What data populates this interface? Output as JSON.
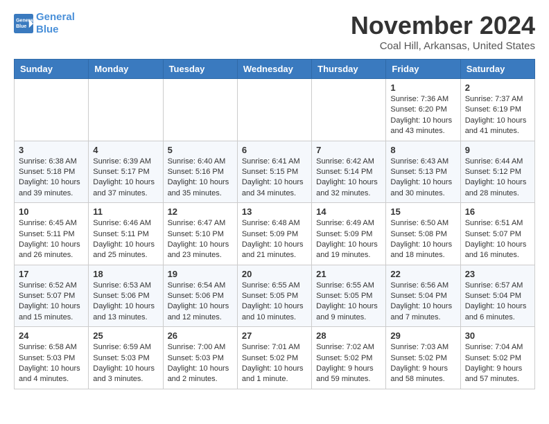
{
  "logo": {
    "line1": "General",
    "line2": "Blue"
  },
  "title": "November 2024",
  "location": "Coal Hill, Arkansas, United States",
  "weekdays": [
    "Sunday",
    "Monday",
    "Tuesday",
    "Wednesday",
    "Thursday",
    "Friday",
    "Saturday"
  ],
  "weeks": [
    [
      {
        "day": "",
        "info": ""
      },
      {
        "day": "",
        "info": ""
      },
      {
        "day": "",
        "info": ""
      },
      {
        "day": "",
        "info": ""
      },
      {
        "day": "",
        "info": ""
      },
      {
        "day": "1",
        "info": "Sunrise: 7:36 AM\nSunset: 6:20 PM\nDaylight: 10 hours and 43 minutes."
      },
      {
        "day": "2",
        "info": "Sunrise: 7:37 AM\nSunset: 6:19 PM\nDaylight: 10 hours and 41 minutes."
      }
    ],
    [
      {
        "day": "3",
        "info": "Sunrise: 6:38 AM\nSunset: 5:18 PM\nDaylight: 10 hours and 39 minutes."
      },
      {
        "day": "4",
        "info": "Sunrise: 6:39 AM\nSunset: 5:17 PM\nDaylight: 10 hours and 37 minutes."
      },
      {
        "day": "5",
        "info": "Sunrise: 6:40 AM\nSunset: 5:16 PM\nDaylight: 10 hours and 35 minutes."
      },
      {
        "day": "6",
        "info": "Sunrise: 6:41 AM\nSunset: 5:15 PM\nDaylight: 10 hours and 34 minutes."
      },
      {
        "day": "7",
        "info": "Sunrise: 6:42 AM\nSunset: 5:14 PM\nDaylight: 10 hours and 32 minutes."
      },
      {
        "day": "8",
        "info": "Sunrise: 6:43 AM\nSunset: 5:13 PM\nDaylight: 10 hours and 30 minutes."
      },
      {
        "day": "9",
        "info": "Sunrise: 6:44 AM\nSunset: 5:12 PM\nDaylight: 10 hours and 28 minutes."
      }
    ],
    [
      {
        "day": "10",
        "info": "Sunrise: 6:45 AM\nSunset: 5:11 PM\nDaylight: 10 hours and 26 minutes."
      },
      {
        "day": "11",
        "info": "Sunrise: 6:46 AM\nSunset: 5:11 PM\nDaylight: 10 hours and 25 minutes."
      },
      {
        "day": "12",
        "info": "Sunrise: 6:47 AM\nSunset: 5:10 PM\nDaylight: 10 hours and 23 minutes."
      },
      {
        "day": "13",
        "info": "Sunrise: 6:48 AM\nSunset: 5:09 PM\nDaylight: 10 hours and 21 minutes."
      },
      {
        "day": "14",
        "info": "Sunrise: 6:49 AM\nSunset: 5:09 PM\nDaylight: 10 hours and 19 minutes."
      },
      {
        "day": "15",
        "info": "Sunrise: 6:50 AM\nSunset: 5:08 PM\nDaylight: 10 hours and 18 minutes."
      },
      {
        "day": "16",
        "info": "Sunrise: 6:51 AM\nSunset: 5:07 PM\nDaylight: 10 hours and 16 minutes."
      }
    ],
    [
      {
        "day": "17",
        "info": "Sunrise: 6:52 AM\nSunset: 5:07 PM\nDaylight: 10 hours and 15 minutes."
      },
      {
        "day": "18",
        "info": "Sunrise: 6:53 AM\nSunset: 5:06 PM\nDaylight: 10 hours and 13 minutes."
      },
      {
        "day": "19",
        "info": "Sunrise: 6:54 AM\nSunset: 5:06 PM\nDaylight: 10 hours and 12 minutes."
      },
      {
        "day": "20",
        "info": "Sunrise: 6:55 AM\nSunset: 5:05 PM\nDaylight: 10 hours and 10 minutes."
      },
      {
        "day": "21",
        "info": "Sunrise: 6:55 AM\nSunset: 5:05 PM\nDaylight: 10 hours and 9 minutes."
      },
      {
        "day": "22",
        "info": "Sunrise: 6:56 AM\nSunset: 5:04 PM\nDaylight: 10 hours and 7 minutes."
      },
      {
        "day": "23",
        "info": "Sunrise: 6:57 AM\nSunset: 5:04 PM\nDaylight: 10 hours and 6 minutes."
      }
    ],
    [
      {
        "day": "24",
        "info": "Sunrise: 6:58 AM\nSunset: 5:03 PM\nDaylight: 10 hours and 4 minutes."
      },
      {
        "day": "25",
        "info": "Sunrise: 6:59 AM\nSunset: 5:03 PM\nDaylight: 10 hours and 3 minutes."
      },
      {
        "day": "26",
        "info": "Sunrise: 7:00 AM\nSunset: 5:03 PM\nDaylight: 10 hours and 2 minutes."
      },
      {
        "day": "27",
        "info": "Sunrise: 7:01 AM\nSunset: 5:02 PM\nDaylight: 10 hours and 1 minute."
      },
      {
        "day": "28",
        "info": "Sunrise: 7:02 AM\nSunset: 5:02 PM\nDaylight: 9 hours and 59 minutes."
      },
      {
        "day": "29",
        "info": "Sunrise: 7:03 AM\nSunset: 5:02 PM\nDaylight: 9 hours and 58 minutes."
      },
      {
        "day": "30",
        "info": "Sunrise: 7:04 AM\nSunset: 5:02 PM\nDaylight: 9 hours and 57 minutes."
      }
    ]
  ]
}
